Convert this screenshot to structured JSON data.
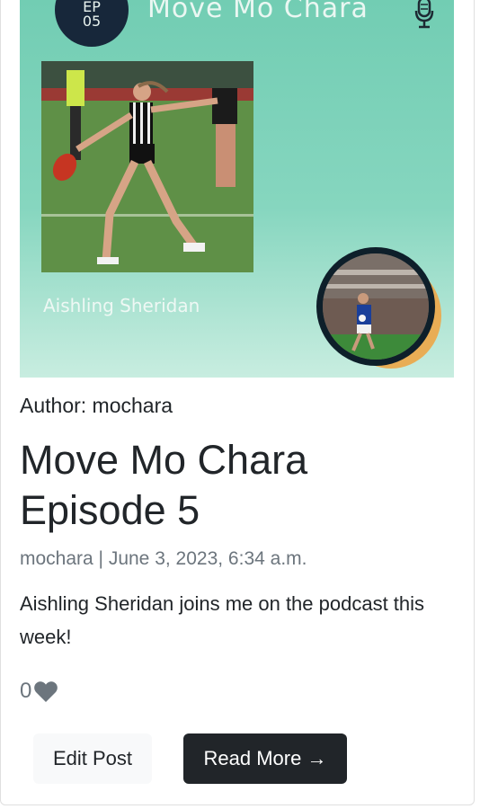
{
  "cover": {
    "badge_line1": "EP",
    "badge_line2": "05",
    "show_title": "Move Mo Chara",
    "guest_name": "Aishling Sheridan",
    "colors": {
      "background": "#7fd2bb",
      "badge": "#17273a",
      "accent_circle": "#e8ad55"
    }
  },
  "post": {
    "author_line": "Author: mochara",
    "title": "Move Mo Chara Episode 5",
    "meta": "mochara | June 3, 2023, 6:34 a.m.",
    "excerpt": "Aishling Sheridan joins me on the podcast this week!",
    "like_count": "0",
    "like_icon": "heart-icon"
  },
  "actions": {
    "edit_label": "Edit Post",
    "read_more_label": "Read More →"
  }
}
